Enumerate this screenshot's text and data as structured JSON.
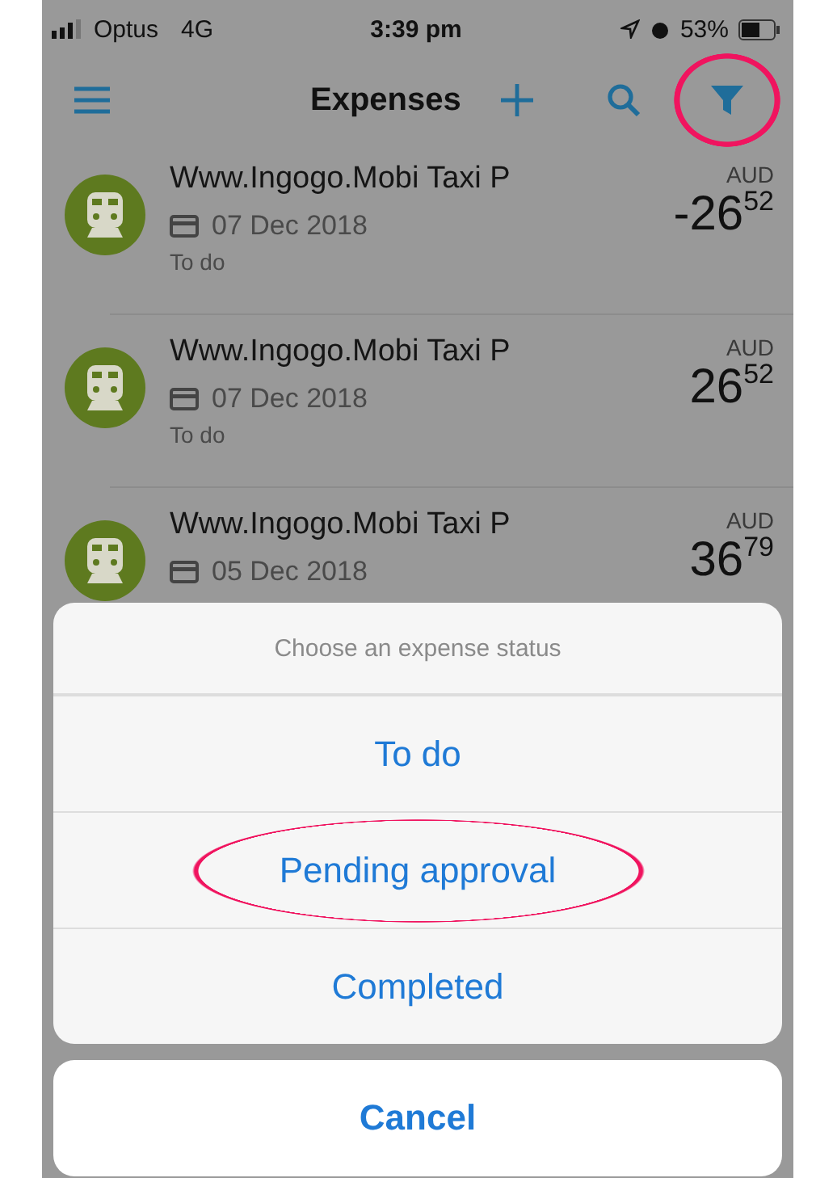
{
  "status_bar": {
    "carrier": "Optus",
    "network": "4G",
    "time": "3:39 pm",
    "battery": "53%"
  },
  "nav": {
    "title": "Expenses",
    "buttons": [
      {
        "kind": "menu",
        "circled": false
      },
      {
        "kind": "add",
        "circled": false
      },
      {
        "kind": "search",
        "circled": false
      },
      {
        "kind": "filter",
        "circled": true
      }
    ]
  },
  "expenses": [
    {
      "merchant": "Www.Ingogo.Mobi Taxi P",
      "date": "07 Dec 2018",
      "status": "To do",
      "currency": "AUD",
      "amount": "-26",
      "cents": "52"
    },
    {
      "merchant": "Www.Ingogo.Mobi Taxi P",
      "date": "07 Dec 2018",
      "status": "To do",
      "currency": "AUD",
      "amount": "26",
      "cents": "52"
    },
    {
      "merchant": "Www.Ingogo.Mobi Taxi P",
      "date": "05 Dec 2018",
      "currency": "AUD",
      "amount": "36",
      "cents": "79"
    }
  ],
  "action_sheet": {
    "title": "Choose an expense status",
    "options": [
      {
        "label": "To do",
        "circled": false
      },
      {
        "label": "Pending approval",
        "circled": true
      },
      {
        "label": "Completed",
        "circled": false
      }
    ],
    "cancel": "Cancel"
  }
}
